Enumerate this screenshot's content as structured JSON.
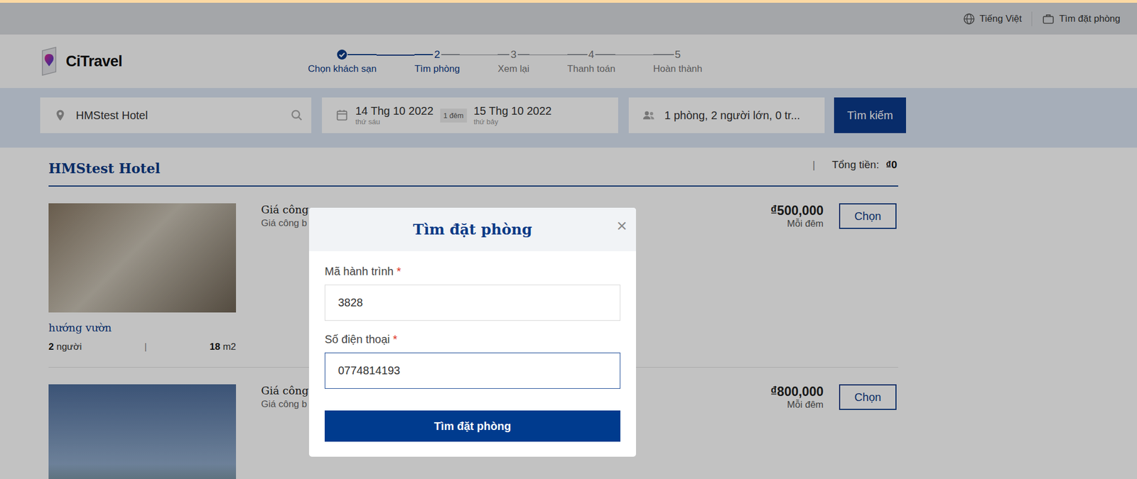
{
  "top_bar": {
    "language": "Tiếng Việt",
    "find_booking": "Tìm đặt phòng"
  },
  "brand": "CiTravel",
  "steps": [
    {
      "label": "Chọn khách sạn",
      "done": true,
      "selected": false
    },
    {
      "number": "2",
      "label": "Tìm phòng",
      "done": false,
      "selected": true
    },
    {
      "number": "3",
      "label": "Xem lại",
      "done": false,
      "selected": false
    },
    {
      "number": "4",
      "label": "Thanh toán",
      "done": false,
      "selected": false
    },
    {
      "number": "5",
      "label": "Hoàn thành",
      "done": false,
      "selected": false
    }
  ],
  "search": {
    "location": "HMStest Hotel",
    "check_in": {
      "date": "14 Thg 10 2022",
      "weekday": "thứ sáu"
    },
    "nights": "1 đêm",
    "check_out": {
      "date": "15 Thg 10 2022",
      "weekday": "thứ bảy"
    },
    "guests": "1 phòng, 2 người lớn, 0 tr...",
    "button": "Tìm kiếm"
  },
  "hotel": {
    "name": "HMStest Hotel",
    "separator": "|",
    "total_label": "Tổng tiền:",
    "total": "₫0"
  },
  "rooms": [
    {
      "title": "Giá công",
      "subtitle": "Giá công b",
      "price": "₫500,000",
      "per": "Mỗi đêm",
      "button": "Chọn",
      "name": "hướng vườn",
      "people": "2",
      "people_unit": "người",
      "separator": "|",
      "area": "18",
      "area_unit": "m2"
    },
    {
      "title": "Giá công",
      "subtitle": "Giá công b",
      "price": "₫800,000",
      "per": "Mỗi đêm",
      "button": "Chọn"
    }
  ],
  "modal": {
    "title": "Tìm đặt phòng",
    "close": "×",
    "fields": [
      {
        "label": "Mã hành trình",
        "required_mark": "*",
        "value": "3828",
        "focused": false
      },
      {
        "label": "Số điện thoại",
        "required_mark": "*",
        "value": "0774814193",
        "focused": true
      }
    ],
    "button": "Tìm đặt phòng"
  }
}
